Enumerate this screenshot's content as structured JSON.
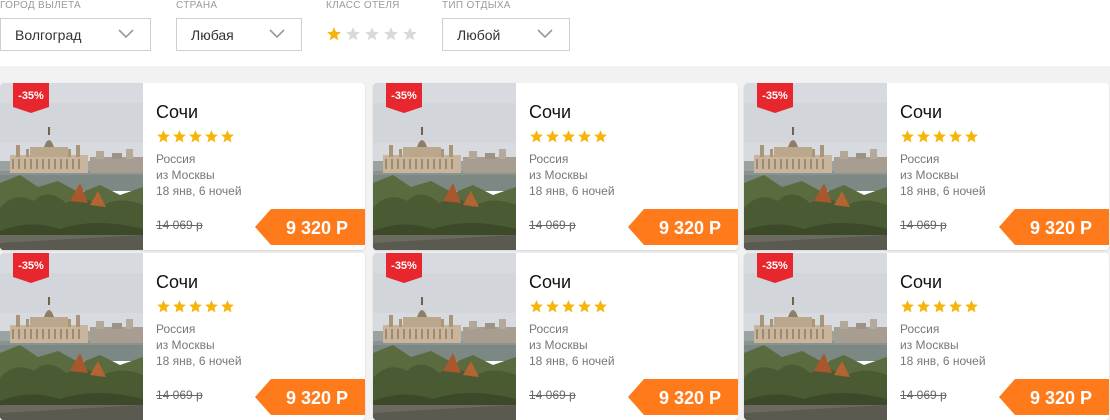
{
  "filters": {
    "departure": {
      "label": "ГОРОД ВЫЛЕТА",
      "value": "Волгоград"
    },
    "country": {
      "label": "СТРАНА",
      "value": "Любая"
    },
    "hotel_class": {
      "label": "КЛАСС ОТЕЛЯ",
      "rating": 1,
      "max": 5
    },
    "rest_type": {
      "label": "ТИП ОТДЫХА",
      "value": "Любой"
    }
  },
  "colors": {
    "accent": "#ff7a1a",
    "badge": "#e8262d",
    "star": "#f5b50a",
    "star_empty": "#d9d9d9"
  },
  "icons": {
    "select_arrow": "chevron-down-icon",
    "rating": "star-icon"
  },
  "offers": [
    {
      "discount": "-35%",
      "city": "Сочи",
      "stars": 5,
      "country": "Россия",
      "from": "из Москвы",
      "dates": "18 янв, 6 ночей",
      "old_price": "14 069 р",
      "price": "9 320 Р"
    },
    {
      "discount": "-35%",
      "city": "Сочи",
      "stars": 5,
      "country": "Россия",
      "from": "из Москвы",
      "dates": "18 янв, 6 ночей",
      "old_price": "14 069 р",
      "price": "9 320 Р"
    },
    {
      "discount": "-35%",
      "city": "Сочи",
      "stars": 5,
      "country": "Россия",
      "from": "из Москвы",
      "dates": "18 янв, 6 ночей",
      "old_price": "14 069 р",
      "price": "9 320 Р"
    },
    {
      "discount": "-35%",
      "city": "Сочи",
      "stars": 5,
      "country": "Россия",
      "from": "из Москвы",
      "dates": "18 янв, 6 ночей",
      "old_price": "14 069 р",
      "price": "9 320 Р"
    },
    {
      "discount": "-35%",
      "city": "Сочи",
      "stars": 5,
      "country": "Россия",
      "from": "из Москвы",
      "dates": "18 янв, 6 ночей",
      "old_price": "14 069 р",
      "price": "9 320 Р"
    },
    {
      "discount": "-35%",
      "city": "Сочи",
      "stars": 5,
      "country": "Россия",
      "from": "из Москвы",
      "dates": "18 янв, 6 ночей",
      "old_price": "14 069 р",
      "price": "9 320 Р"
    }
  ]
}
